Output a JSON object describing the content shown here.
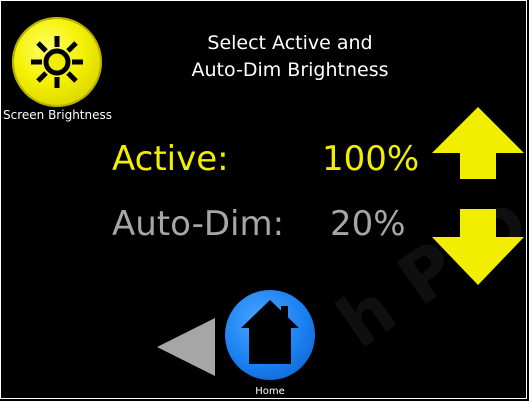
{
  "title": {
    "line1": "Select Active and",
    "line2": "Auto-Dim Brightness"
  },
  "brightness_button": {
    "label": "Screen Brightness",
    "icon": "sun-icon",
    "color": "#f2ee00"
  },
  "rows": {
    "active": {
      "label": "Active:",
      "value": "100%",
      "color": "#f2ee00"
    },
    "auto_dim": {
      "label": "Auto-Dim:",
      "value": "20%",
      "color": "#a6a6a6"
    }
  },
  "controls": {
    "up_icon": "arrow-up-icon",
    "down_icon": "arrow-down-icon",
    "back_icon": "back-arrow-icon"
  },
  "home": {
    "label": "Home",
    "icon": "house-icon",
    "color": "#1a7ff0"
  }
}
